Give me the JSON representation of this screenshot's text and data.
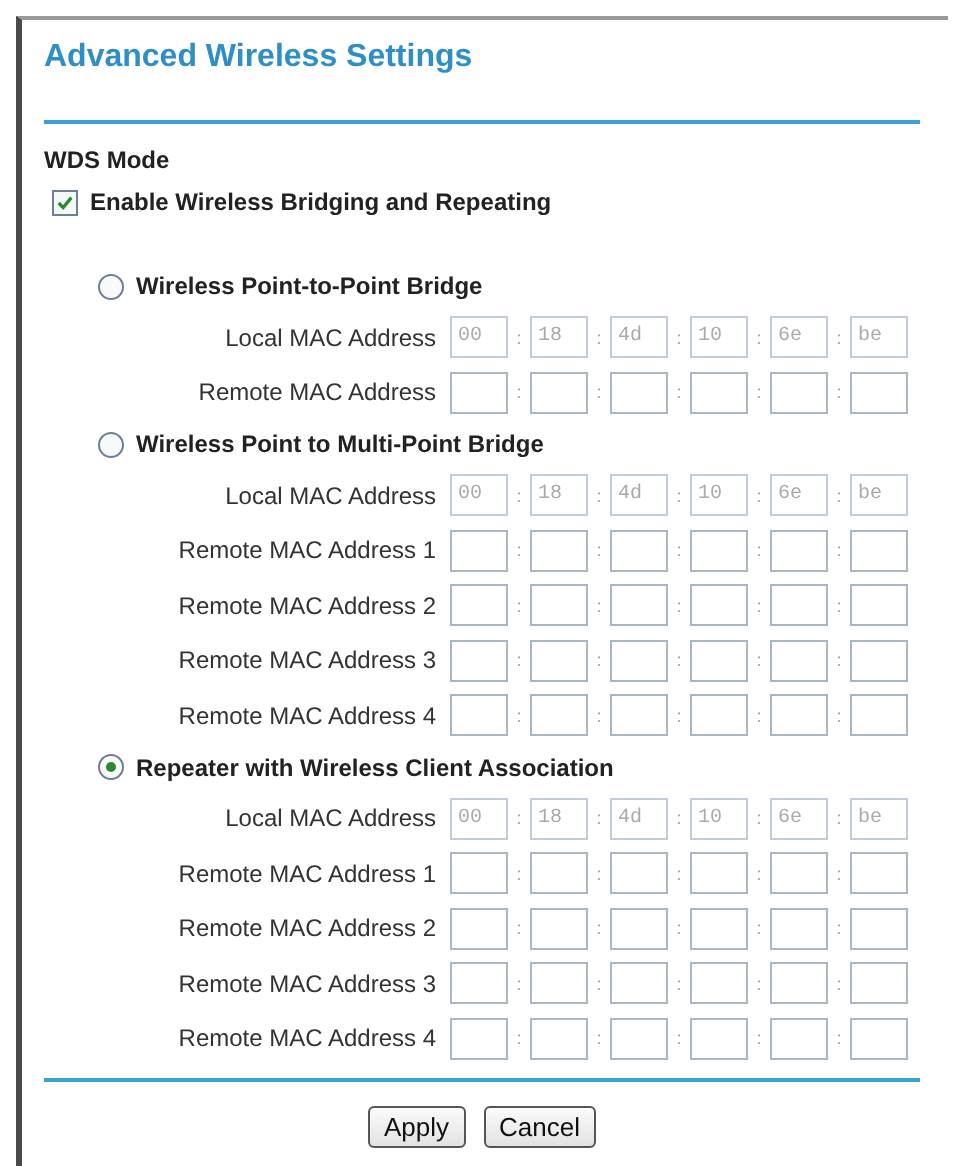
{
  "title": "Advanced Wireless Settings",
  "wds": {
    "heading": "WDS Mode",
    "enable_label": "Enable Wireless Bridging and Repeating",
    "checked": true
  },
  "modes": [
    {
      "label": "Wireless Point-to-Point Bridge",
      "selected": false,
      "rows": [
        {
          "label": "Local MAC Address",
          "separators": [
            ":",
            ":",
            ":",
            ":",
            ":"
          ],
          "fields": [
            {
              "value": "00",
              "disabled": true
            },
            {
              "value": "18",
              "disabled": true
            },
            {
              "value": "4d",
              "disabled": true
            },
            {
              "value": "10",
              "disabled": true
            },
            {
              "value": "6e",
              "disabled": true
            },
            {
              "value": "be",
              "disabled": true
            }
          ]
        },
        {
          "label": "Remote MAC Address",
          "separators": [
            ":",
            ":",
            ":",
            ":",
            ":"
          ],
          "fields": [
            {
              "disabled": false
            },
            {
              "disabled": false
            },
            {
              "disabled": false
            },
            {
              "disabled": false
            },
            {
              "disabled": false
            },
            {
              "disabled": false
            }
          ]
        }
      ]
    },
    {
      "label": "Wireless Point to Multi-Point Bridge",
      "selected": false,
      "rows": [
        {
          "label": "Local MAC Address",
          "separators": [
            ":",
            ":",
            ":",
            ":",
            ":"
          ],
          "fields": [
            {
              "value": "00",
              "disabled": true
            },
            {
              "value": "18",
              "disabled": true
            },
            {
              "value": "4d",
              "disabled": true
            },
            {
              "value": "10",
              "disabled": true
            },
            {
              "value": "6e",
              "disabled": true
            },
            {
              "value": "be",
              "disabled": true
            }
          ]
        },
        {
          "label": "Remote MAC Address 1",
          "separators": [
            ":",
            ":",
            ":",
            ":",
            ":"
          ],
          "fields": [
            {
              "disabled": false
            },
            {
              "disabled": false
            },
            {
              "disabled": false
            },
            {
              "disabled": false
            },
            {
              "disabled": false
            },
            {
              "disabled": false
            }
          ]
        },
        {
          "label": "Remote MAC Address 2",
          "separators": [
            ":",
            ":",
            ":",
            ":",
            ":"
          ],
          "fields": [
            {
              "disabled": false
            },
            {
              "disabled": false
            },
            {
              "disabled": false
            },
            {
              "disabled": false
            },
            {
              "disabled": false
            },
            {
              "disabled": false
            }
          ]
        },
        {
          "label": "Remote MAC Address 3",
          "separators": [
            ":",
            ":",
            ":",
            ":",
            ":"
          ],
          "fields": [
            {
              "disabled": false
            },
            {
              "disabled": false
            },
            {
              "disabled": false
            },
            {
              "disabled": false
            },
            {
              "disabled": false
            },
            {
              "disabled": false
            }
          ]
        },
        {
          "label": "Remote MAC Address 4",
          "separators": [
            ":",
            ":",
            ":",
            ":",
            ":"
          ],
          "fields": [
            {
              "disabled": false
            },
            {
              "disabled": false
            },
            {
              "disabled": false
            },
            {
              "disabled": false
            },
            {
              "disabled": false
            },
            {
              "disabled": false
            }
          ]
        }
      ]
    },
    {
      "label": "Repeater with Wireless Client Association",
      "selected": true,
      "rows": [
        {
          "label": "Local MAC Address",
          "separators": [
            ":",
            ":",
            ":",
            ":",
            ":"
          ],
          "fields": [
            {
              "value": "00",
              "disabled": true
            },
            {
              "value": "18",
              "disabled": true
            },
            {
              "value": "4d",
              "disabled": true
            },
            {
              "value": "10",
              "disabled": true
            },
            {
              "value": "6e",
              "disabled": true
            },
            {
              "value": "be",
              "disabled": true
            }
          ]
        },
        {
          "label": "Remote MAC Address 1",
          "separators": [
            ":",
            ":",
            ":",
            ":",
            ":"
          ],
          "fields": [
            {
              "disabled": false
            },
            {
              "disabled": false
            },
            {
              "disabled": false
            },
            {
              "disabled": false
            },
            {
              "disabled": false
            },
            {
              "disabled": false
            }
          ]
        },
        {
          "label": "Remote MAC Address 2",
          "separators": [
            ":",
            ":",
            ":",
            ":",
            ":"
          ],
          "fields": [
            {
              "disabled": false
            },
            {
              "disabled": false
            },
            {
              "disabled": false
            },
            {
              "disabled": false
            },
            {
              "disabled": false
            },
            {
              "disabled": false
            }
          ]
        },
        {
          "label": "Remote MAC Address 3",
          "separators": [
            ":",
            ":",
            ":",
            ":",
            ":"
          ],
          "fields": [
            {
              "disabled": false
            },
            {
              "disabled": false
            },
            {
              "disabled": false
            },
            {
              "disabled": false
            },
            {
              "disabled": false
            },
            {
              "disabled": false
            }
          ]
        },
        {
          "label": "Remote MAC Address 4",
          "separators": [
            ":",
            ":",
            ":",
            ":",
            ":"
          ],
          "fields": [
            {
              "disabled": false
            },
            {
              "disabled": false
            },
            {
              "disabled": false
            },
            {
              "disabled": false
            },
            {
              "disabled": false
            },
            {
              "disabled": false
            }
          ]
        }
      ]
    }
  ],
  "buttons": [
    "Apply",
    "Cancel"
  ]
}
